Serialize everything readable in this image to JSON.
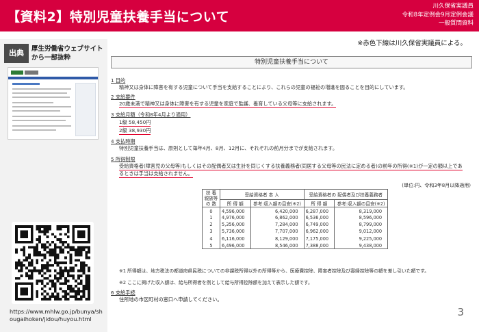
{
  "header": {
    "title": "【資料2】特別児童扶養手当について",
    "meta": [
      "川久保省実議員",
      "令和8年定例会9月定例会議",
      "一般質問資料"
    ]
  },
  "note": "※赤色下線は川久保省実議員による。",
  "source": {
    "badge": "出典",
    "lines": [
      "厚生労働省ウェブサイト",
      "から一部抜粋"
    ],
    "url": "https://www.mhlw.go.jp/bunya/shougaihoken/jidou/huyou.html"
  },
  "doc": {
    "title": "特別児童扶養手当について",
    "s1_head": "1  目的",
    "s1_body": "精神又は身体に障害を有する児童について手当を支給することにより、これらの児童の福祉の増進を図ることを目的にしています。",
    "s2_head": "2  支給要件",
    "s2_body": "20歳未満で精神又は身体に障害を有する児童を家庭で監護、養育している父母等に支給されます。",
    "s3_head": "3  支給月額（令和8年4月より適用）",
    "s3_l1": "1級  58,450円",
    "s3_l2": "2級  38,930円",
    "s4_head": "4  支払時期",
    "s4_body": "特別児童扶養手当は、原則として毎年4月、8月、12月に、それぞれの前月分までが支給されます。",
    "s5_head": "5  所得制限",
    "s5_b1": "受給資格者(障害児の父母等)もしくはその配偶者又は生計を同じくする扶養義務者(同居する父母等の民法に定める者)の前年の所得(※1)が一定の額以上であ",
    "s5_b2": "るときは手当は支給されません。",
    "unit": "(単位:円、令和3年8月以降適用)",
    "s6_head": "6  支給手続",
    "s6_body": "住所地の市区町村の窓口へ申請してください。"
  },
  "table": {
    "h_dep": "扶 養 親族等 の 数",
    "h_recipient": "受給資格者 本  人",
    "h_spouse": "受給資格者の 配偶者及び扶養義務者",
    "sub_income": "所 得 額",
    "sub_ref": "参考:収入額の目安(※2)",
    "rows": [
      {
        "n": "0",
        "a": "4,596,000",
        "b": "6,420,000",
        "c": "6,287,000",
        "d": "8,319,000"
      },
      {
        "n": "1",
        "a": "4,976,000",
        "b": "6,862,000",
        "c": "6,536,000",
        "d": "8,596,000"
      },
      {
        "n": "2",
        "a": "5,356,000",
        "b": "7,284,000",
        "c": "6,749,000",
        "d": "8,799,000"
      },
      {
        "n": "3",
        "a": "5,736,000",
        "b": "7,707,000",
        "c": "6,962,000",
        "d": "9,012,000"
      },
      {
        "n": "4",
        "a": "6,116,000",
        "b": "8,129,000",
        "c": "7,175,000",
        "d": "9,225,000"
      },
      {
        "n": "5",
        "a": "6,496,000",
        "b": "8,546,000",
        "c": "7,388,000",
        "d": "9,438,000"
      }
    ]
  },
  "footnotes": {
    "n1": "※1  所得額は、地方税法の都道府県民税についての非課税所得以外の所得等から、医療費控除、障害者控除及び寡婦控除等の額を差し引いた額です。",
    "n2": "※2  ここに掲げた収入額は、給与所得者を例として給与所得控除額を加えて表示した額です。"
  },
  "page_number": "3",
  "colors": {
    "accent": "#d6003f",
    "underline": "#e0002a"
  }
}
